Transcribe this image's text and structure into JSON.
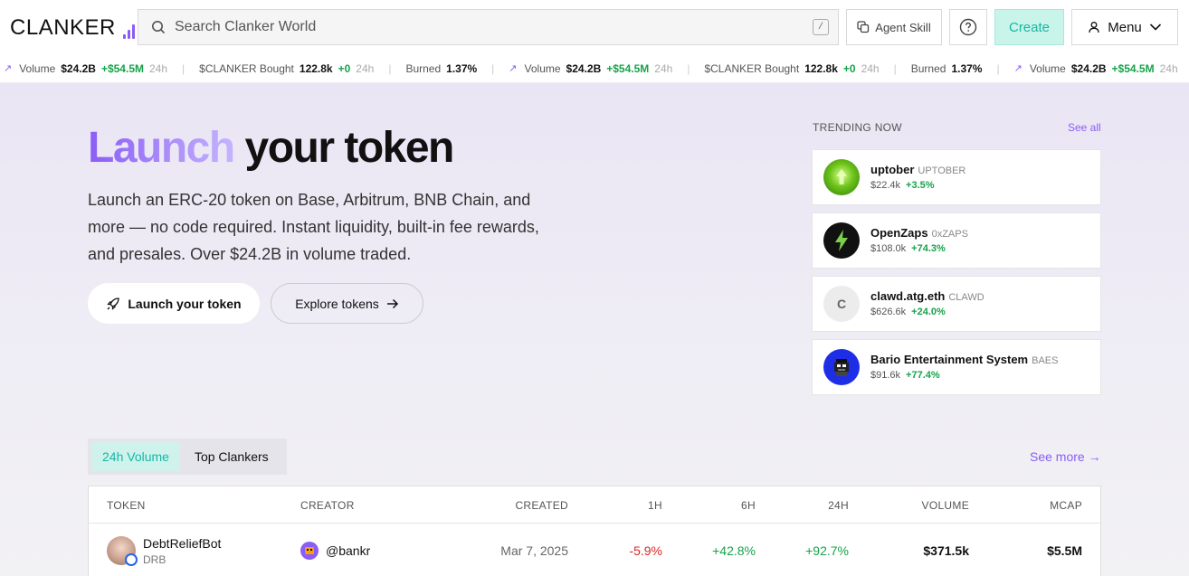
{
  "header": {
    "logo": "CLANKER",
    "search_placeholder": "Search Clanker World",
    "search_shortcut": "/",
    "agent_skill": "Agent Skill",
    "create": "Create",
    "menu": "Menu",
    "accent": "#8b5cf6"
  },
  "ticker": {
    "items": [
      {
        "label": "Volume",
        "value": "$24.2B",
        "change": "+$54.5M",
        "period": "24h"
      },
      {
        "label": "$CLANKER Bought",
        "value": "122.8k",
        "change": "+0",
        "period": "24h"
      },
      {
        "label": "Burned",
        "value": "1.37%"
      },
      {
        "label": "Volume",
        "value": "$24.2B",
        "change": "+$54.5M",
        "period": "24h"
      },
      {
        "label": "$CLANKER Bought",
        "value": "122.8k",
        "change": "+0",
        "period": "24h"
      },
      {
        "label": "Burned",
        "value": "1.37%"
      },
      {
        "label": "Volume",
        "value": "$24.2B",
        "change": "+$54.5M",
        "period": "24h"
      }
    ]
  },
  "hero": {
    "title_highlight": "Launch",
    "title_rest": " your token",
    "description": "Launch an ERC-20 token on Base, Arbitrum, BNB Chain, and more — no code required. Instant liquidity, built-in fee rewards, and presales. Over $24.2B in volume traded.",
    "launch_button": "Launch your token",
    "explore_button": "Explore tokens"
  },
  "trending": {
    "heading": "TRENDING NOW",
    "see_all": "See all",
    "items": [
      {
        "name": "uptober",
        "ticker": "UPTOBER",
        "price": "$22.4k",
        "change": "+3.5%"
      },
      {
        "name": "OpenZaps",
        "ticker": "0xZAPS",
        "price": "$108.0k",
        "change": "+74.3%"
      },
      {
        "name": "clawd.atg.eth",
        "ticker": "CLAWD",
        "price": "$626.6k",
        "change": "+24.0%",
        "avatar_letter": "C"
      },
      {
        "name": "Bario Entertainment System",
        "ticker": "BAES",
        "price": "$91.6k",
        "change": "+77.4%"
      }
    ]
  },
  "tabs": {
    "active": "24h Volume",
    "inactive": "Top Clankers",
    "see_more": "See more"
  },
  "table": {
    "columns": [
      "TOKEN",
      "CREATOR",
      "CREATED",
      "1H",
      "6H",
      "24H",
      "VOLUME",
      "MCAP"
    ],
    "rows": [
      {
        "token": "DebtReliefBot",
        "ticker": "DRB",
        "creator": "@bankr",
        "created": "Mar 7, 2025",
        "h1": "-5.9%",
        "h6": "+42.8%",
        "h24": "+92.7%",
        "volume": "$371.5k",
        "mcap": "$5.5M"
      }
    ]
  }
}
